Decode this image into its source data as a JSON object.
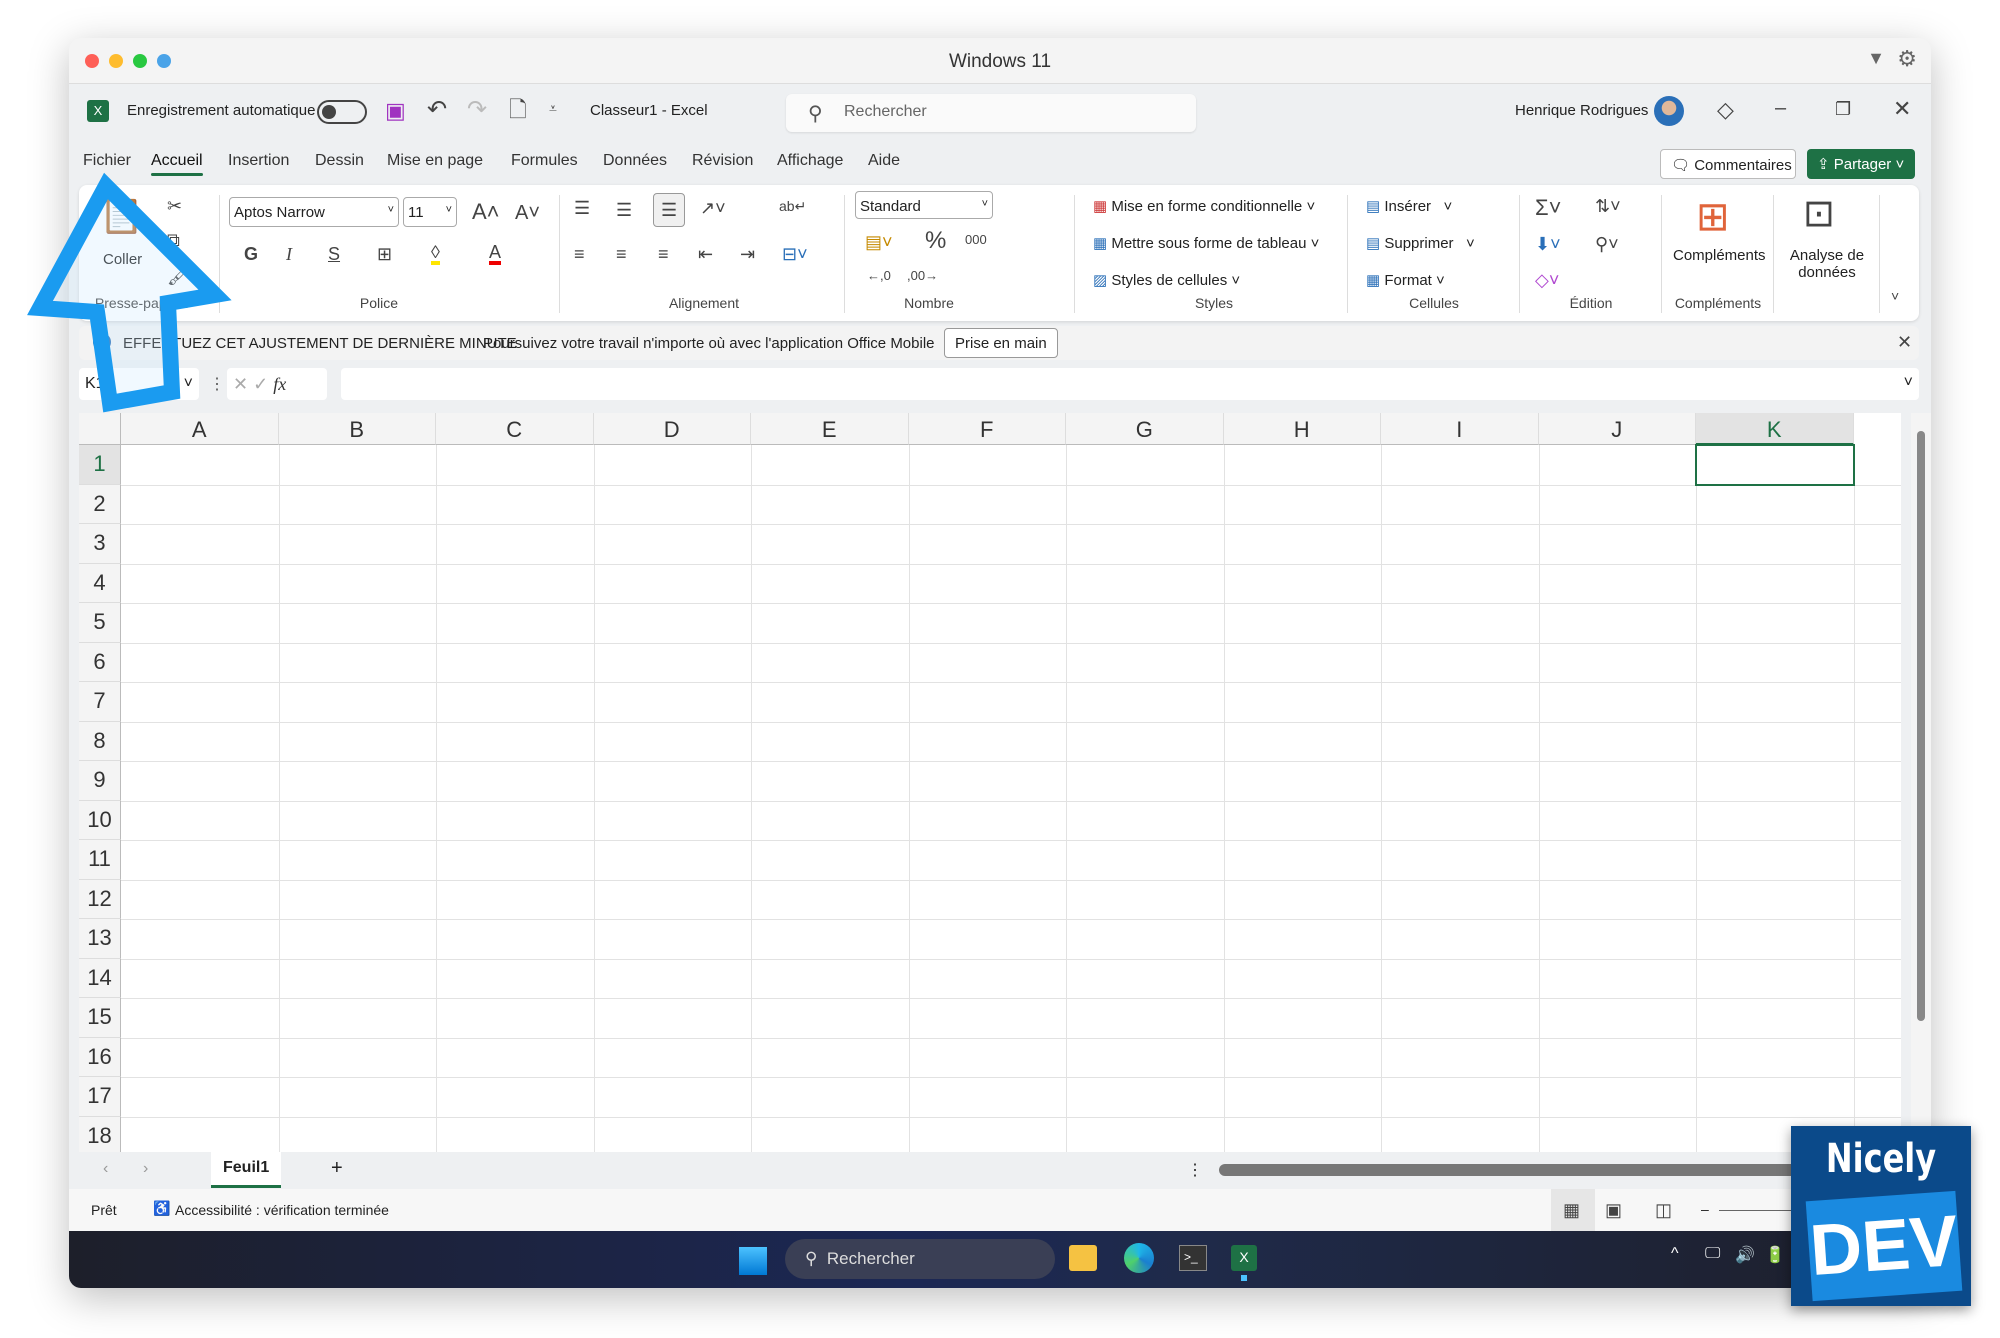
{
  "window": {
    "title": "Windows 11"
  },
  "qat": {
    "autosave_label": "Enregistrement automatique",
    "doc_title": "Classeur1  -  Excel",
    "search_placeholder": "Rechercher",
    "user": "Henrique Rodrigues"
  },
  "tabs": [
    {
      "label": "Fichier"
    },
    {
      "label": "Accueil",
      "active": true
    },
    {
      "label": "Insertion"
    },
    {
      "label": "Dessin"
    },
    {
      "label": "Mise en page"
    },
    {
      "label": "Formules"
    },
    {
      "label": "Données"
    },
    {
      "label": "Révision"
    },
    {
      "label": "Affichage"
    },
    {
      "label": "Aide"
    }
  ],
  "header_buttons": {
    "comments": "Commentaires",
    "share": "Partager"
  },
  "ribbon": {
    "clipboard": {
      "paste": "Coller",
      "label": "Presse-papiers"
    },
    "font": {
      "name": "Aptos Narrow",
      "size": "11",
      "bold": "G",
      "italic": "I",
      "underline": "S",
      "label": "Police"
    },
    "alignment": {
      "label": "Alignement"
    },
    "number": {
      "format": "Standard",
      "label": "Nombre"
    },
    "styles": {
      "conditional": "Mise en forme conditionnelle",
      "table": "Mettre sous forme de tableau",
      "cell_styles": "Styles de cellules",
      "label": "Styles"
    },
    "cells": {
      "insert": "Insérer",
      "delete": "Supprimer",
      "format": "Format",
      "label": "Cellules"
    },
    "editing": {
      "label": "Édition"
    },
    "addins": {
      "button": "Compléments",
      "label": "Compléments"
    },
    "analyze": {
      "line1": "Analyse de",
      "line2": "données"
    }
  },
  "infobar": {
    "title": "EFFECTUEZ CET AJUSTEMENT DE DERNIÈRE MINUTE",
    "message": "Poursuivez votre travail n'importe où avec l'application Office Mobile",
    "button": "Prise en main"
  },
  "formula_bar": {
    "name_box": "K1",
    "fx": "fx",
    "value": ""
  },
  "grid": {
    "columns": [
      "A",
      "B",
      "C",
      "D",
      "E",
      "F",
      "G",
      "H",
      "I",
      "J",
      "K"
    ],
    "rows": [
      1,
      2,
      3,
      4,
      5,
      6,
      7,
      8,
      9,
      10,
      11,
      12,
      13,
      14,
      15,
      16,
      17,
      18
    ],
    "active_cell": "K1"
  },
  "sheets": {
    "tabs": [
      "Feuil1"
    ],
    "active": "Feuil1",
    "add": "+"
  },
  "status": {
    "ready": "Prêt",
    "accessibility": "Accessibilité : vérification terminée"
  },
  "taskbar": {
    "search": "Rechercher"
  },
  "badge": {
    "line1": "Nicely",
    "line2": "DEV"
  },
  "colors": {
    "excel_green": "#1e7145",
    "overlay_arrow": "#1a9bf0"
  }
}
